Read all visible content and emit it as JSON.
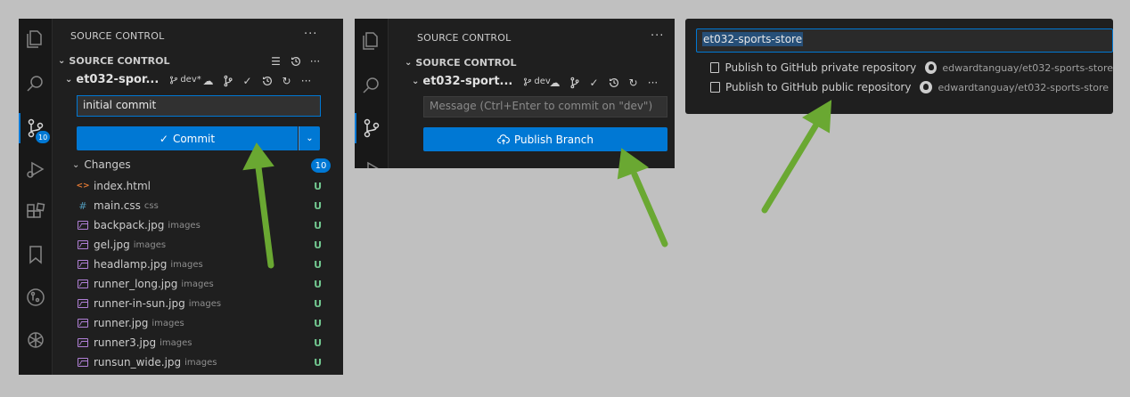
{
  "panel1": {
    "view_title": "SOURCE CONTROL",
    "more": "···",
    "section_title": "SOURCE CONTROL",
    "repo_name": "et032-spor...",
    "branch": "dev*",
    "commit_message": "initial commit",
    "commit_label": "Commit",
    "commit_check": "✓",
    "scm_badge": "10",
    "changes_label": "Changes",
    "changes_count": "10",
    "files": [
      {
        "name": "index.html",
        "dir": "",
        "status": "U",
        "icon": "html-icon"
      },
      {
        "name": "main.css",
        "dir": "css",
        "status": "U",
        "icon": "css-icon"
      },
      {
        "name": "backpack.jpg",
        "dir": "images",
        "status": "U",
        "icon": "image-icon"
      },
      {
        "name": "gel.jpg",
        "dir": "images",
        "status": "U",
        "icon": "image-icon"
      },
      {
        "name": "headlamp.jpg",
        "dir": "images",
        "status": "U",
        "icon": "image-icon"
      },
      {
        "name": "runner_long.jpg",
        "dir": "images",
        "status": "U",
        "icon": "image-icon"
      },
      {
        "name": "runner-in-sun.jpg",
        "dir": "images",
        "status": "U",
        "icon": "image-icon"
      },
      {
        "name": "runner.jpg",
        "dir": "images",
        "status": "U",
        "icon": "image-icon"
      },
      {
        "name": "runner3.jpg",
        "dir": "images",
        "status": "U",
        "icon": "image-icon"
      },
      {
        "name": "runsun_wide.jpg",
        "dir": "images",
        "status": "U",
        "icon": "image-icon"
      }
    ]
  },
  "panel2": {
    "view_title": "SOURCE CONTROL",
    "more": "···",
    "section_title": "SOURCE CONTROL",
    "repo_name": "et032-sport...",
    "branch": "dev",
    "message_placeholder": "Message (Ctrl+Enter to commit on \"dev\")",
    "publish_label": "Publish Branch"
  },
  "panel3": {
    "query": "et032-sports-store",
    "options": [
      {
        "label": "Publish to GitHub private repository",
        "user": "edwardtanguay/et032-sports-store"
      },
      {
        "label": "Publish to GitHub public repository",
        "user": "edwardtanguay/et032-sports-store"
      }
    ]
  },
  "colors": {
    "accent": "#0078d4",
    "untracked": "#73c991",
    "arrow": "#6aa832"
  }
}
